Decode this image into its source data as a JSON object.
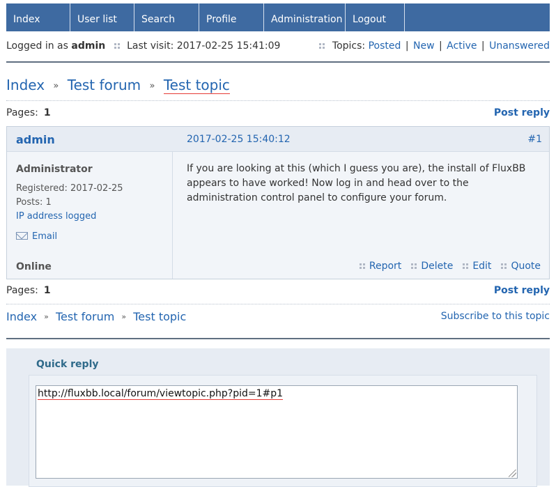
{
  "nav": [
    "Index",
    "User list",
    "Search",
    "Profile",
    "Administration",
    "Logout"
  ],
  "status": {
    "logged_in_prefix": "Logged in as",
    "username": "admin",
    "last_visit": "Last visit: 2017-02-25 15:41:09",
    "topics_label": "Topics:",
    "topics_links": [
      "Posted",
      "New",
      "Active",
      "Unanswered"
    ]
  },
  "breadcrumb": {
    "items": [
      "Index",
      "Test forum",
      "Test topic"
    ],
    "separator": "»"
  },
  "pages": {
    "label": "Pages:",
    "current": "1",
    "post_reply": "Post reply"
  },
  "post": {
    "author": "admin",
    "date": "2017-02-25 15:40:12",
    "number": "#1",
    "user_title": "Administrator",
    "registered": "Registered: 2017-02-25",
    "posts": "Posts: 1",
    "ip": "IP address logged",
    "email": "Email",
    "online": "Online",
    "body_lines": [
      "If you are looking at this (which I guess you are), the install of FluxBB",
      "appears to have worked! Now log in and head over to the",
      "administration control panel to configure your forum."
    ],
    "actions": [
      "Report",
      "Delete",
      "Edit",
      "Quote"
    ]
  },
  "subscribe": "Subscribe to this topic",
  "quick_reply": {
    "title": "Quick reply",
    "value": "http://fluxbb.local/forum/viewtopic.php?pid=1#p1"
  },
  "colors": {
    "nav_bg": "#3e6aa1",
    "link": "#2365b0",
    "post_bg": "#f2f5f9"
  }
}
